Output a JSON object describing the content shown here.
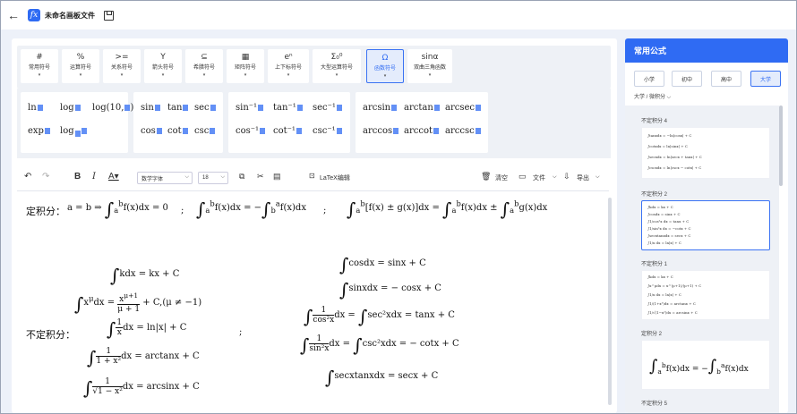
{
  "app": {
    "title": "未命名画板文件"
  },
  "tabs": [
    {
      "icon": "#",
      "label": "常用符号"
    },
    {
      "icon": "%",
      "label": "运算符号"
    },
    {
      "icon": ">=",
      "label": "关系符号"
    },
    {
      "icon": "Y",
      "label": "箭头符号"
    },
    {
      "icon": "⊆",
      "label": "希腊符号"
    },
    {
      "icon": "▦",
      "label": "矩阵符号"
    },
    {
      "icon": "eⁿ",
      "label": "上下标符号"
    },
    {
      "icon": "Σ₀⁰",
      "label": "大型运算符号"
    },
    {
      "icon": "Ω",
      "label": "函数符号"
    },
    {
      "icon": "sinα",
      "label": "双曲三角函数"
    }
  ],
  "symbols": {
    "log_group": [
      "ln",
      "log",
      "log(10,",
      "exp",
      "log"
    ],
    "trig": [
      "sin",
      "tan",
      "sec",
      "cos",
      "cot",
      "csc"
    ],
    "inv": [
      "sin⁻¹",
      "tan⁻¹",
      "sec⁻¹",
      "cos⁻¹",
      "cot⁻¹",
      "csc⁻¹"
    ],
    "arc": [
      "arcsin",
      "arctan",
      "arcsec",
      "arccos",
      "arccot",
      "arccsc"
    ]
  },
  "toolbar": {
    "font": "数学字体",
    "size": "18",
    "latex": "LaTeX编辑",
    "clear": "清空",
    "file": "文件",
    "export": "导出"
  },
  "editor": {
    "def_label": "定积分：",
    "def_eq1": "a = b ⇒",
    "def_eq1b": "f(x)dx = 0",
    "semi": ";",
    "indef_label": "不定积分：",
    "lines": [
      "kdx = kx + C",
      "cosdx = sinx + C",
      "sinxdx = − cosx + C",
      "ln|x| + C",
      "sec²xdx = tanx + C",
      "arctanx + C",
      "csc²xdx = − cotx + C",
      "arcsinx + C",
      "secxtanxdx = secx + C"
    ]
  },
  "side": {
    "title": "常用公式",
    "levels": [
      "小学",
      "初中",
      "高中",
      "大学"
    ],
    "crumb": "大学 / 微积分 ⌵",
    "cards": [
      "不定积分 4",
      "不定积分 2",
      "不定积分 1",
      "定积分 2",
      "不定积分 5"
    ]
  }
}
